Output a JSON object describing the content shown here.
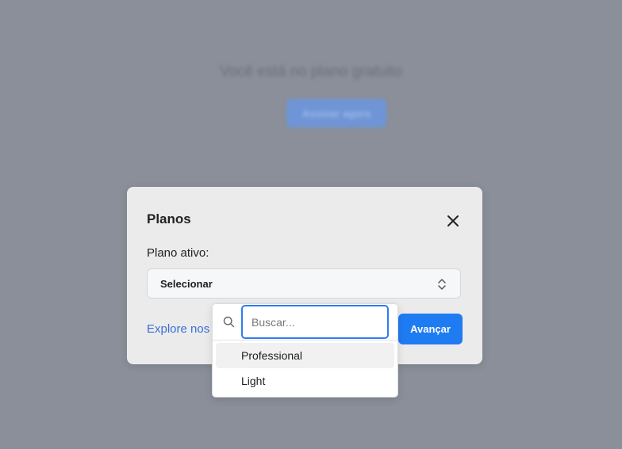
{
  "background": {
    "title": "Você está no plano gratuito",
    "button_label": "Assinar agora"
  },
  "modal": {
    "title": "Planos",
    "field_label": "Plano ativo:",
    "select_value": "Selecionar",
    "explore_link": "Explore nos",
    "next_button": "Avançar"
  },
  "dropdown": {
    "search_placeholder": "Buscar...",
    "options": [
      {
        "label": "Professional",
        "highlighted": true
      },
      {
        "label": "Light",
        "highlighted": false
      }
    ]
  },
  "colors": {
    "accent": "#1f7bf2",
    "link": "#3b6fd6",
    "overlay": "#8a8f99"
  }
}
